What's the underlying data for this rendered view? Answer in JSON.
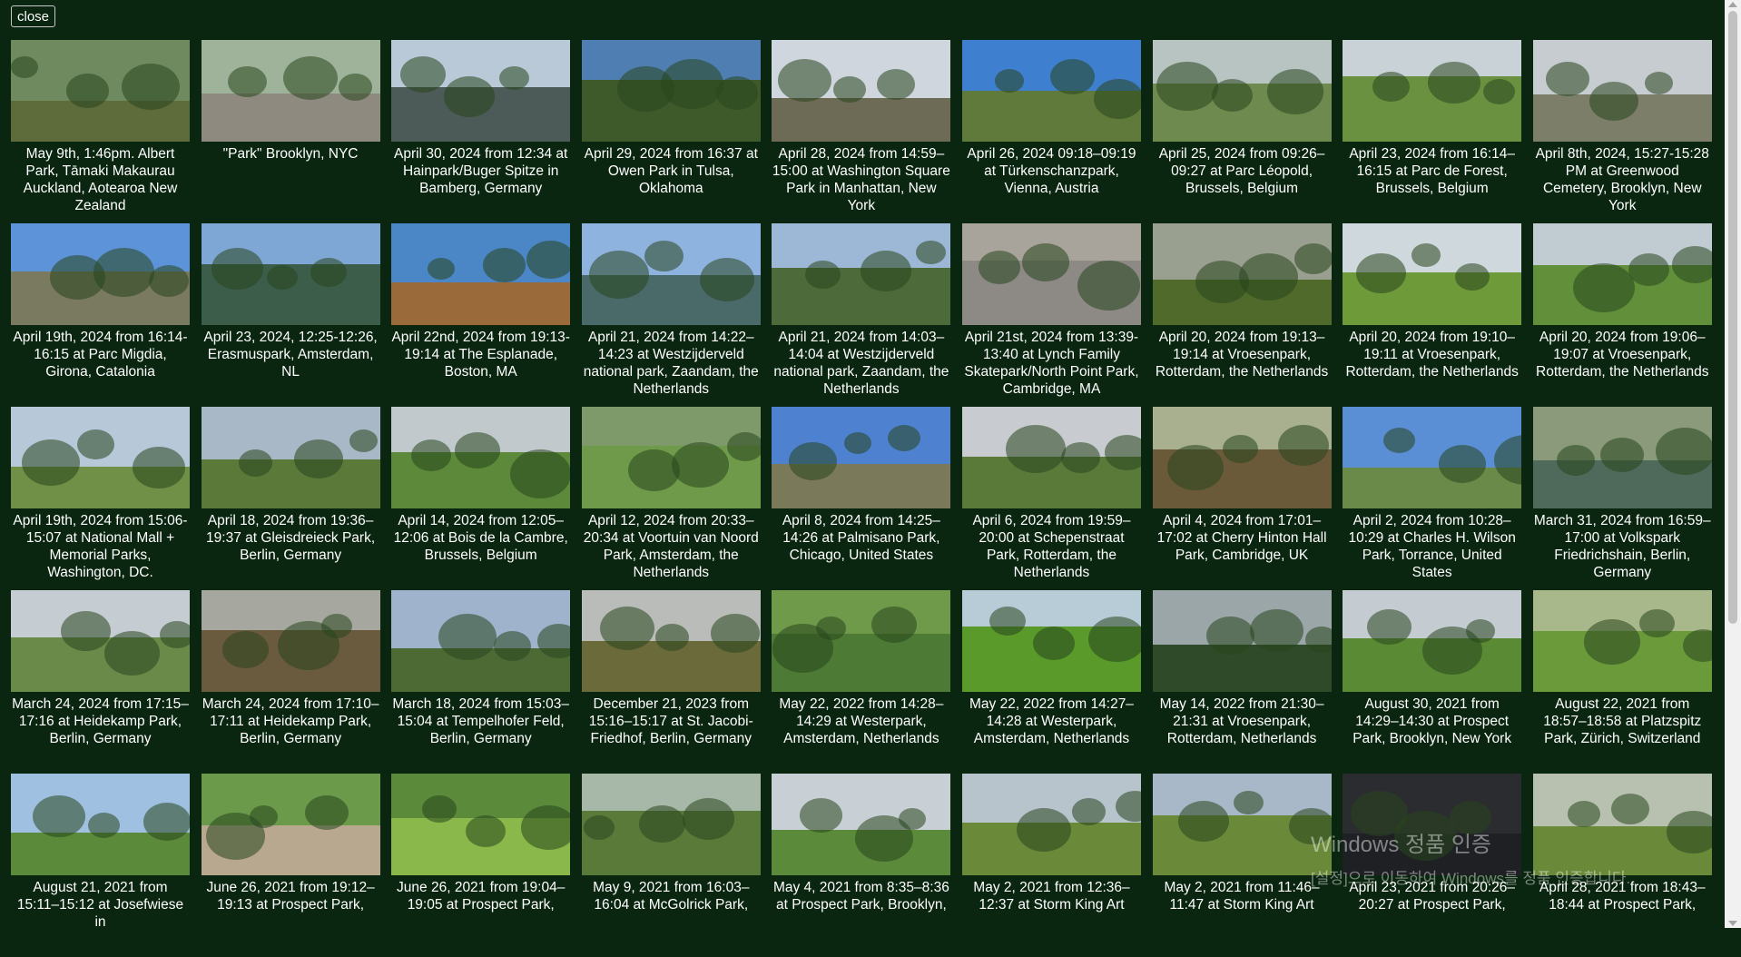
{
  "close_label": "close",
  "watermark": {
    "title": "Windows 정품 인증",
    "subtitle": "[설정]으로 이동하여 Windows를 정품 인증합니다."
  },
  "items": [
    {
      "caption": "May 9th, 1:46pm. Albert Park, Tāmaki Makaurau Auckland, Aotearoa New Zealand",
      "sky": "#6f8a5e",
      "ground": "#5e6b3a"
    },
    {
      "caption": "\"Park\" Brooklyn, NYC",
      "sky": "#9fb39a",
      "ground": "#8f8a80"
    },
    {
      "caption": "April 30, 2024 from 12:34 at Hainpark/Buger Spitze in Bamberg, Germany",
      "sky": "#b9c9d8",
      "ground": "#4c5a58"
    },
    {
      "caption": "April 29, 2024 from 16:37 at Owen Park in Tulsa, Oklahoma",
      "sky": "#4f7fb2",
      "ground": "#3f5a2a"
    },
    {
      "caption": "April 28, 2024 from 14:59–15:00 at Washington Square Park in Manhattan, New York",
      "sky": "#cfd6de",
      "ground": "#6d6a55"
    },
    {
      "caption": "April 26, 2024 09:18–09:19 at Türkenschanzpark, Vienna, Austria",
      "sky": "#3f7fd0",
      "ground": "#5f7a3a"
    },
    {
      "caption": "April 25, 2024 from 09:26–09:27 at Parc Léopold, Brussels, Belgium",
      "sky": "#b8c4c2",
      "ground": "#6f8a4e"
    },
    {
      "caption": "April 23, 2024 from 16:14–16:15 at Parc de Forest, Brussels, Belgium",
      "sky": "#c9d2d6",
      "ground": "#6a9140"
    },
    {
      "caption": "April 8th, 2024, 15:27-15:28 PM at Greenwood Cemetery, Brooklyn, New York",
      "sky": "#c7ccd0",
      "ground": "#7d7e6a"
    },
    {
      "caption": "April 19th, 2024 from 16:14-16:15 at Parc Migdia, Girona, Catalonia",
      "sky": "#5d93d8",
      "ground": "#7a7a60"
    },
    {
      "caption": "April 23, 2024, 12:25-12:26, Erasmuspark, Amsterdam, NL",
      "sky": "#7fa7d6",
      "ground": "#3b5d4a"
    },
    {
      "caption": "April 22nd, 2024 from 19:13-19:14 at The Esplanade, Boston, MA",
      "sky": "#4b86c6",
      "ground": "#9a6a3a"
    },
    {
      "caption": "April 21, 2024 from 14:22–14:23 at Westzijderveld national park, Zaandam, the Netherlands",
      "sky": "#8fb3df",
      "ground": "#4a6a6a"
    },
    {
      "caption": "April 21, 2024 from 14:03–14:04 at Westzijderveld national park, Zaandam, the Netherlands",
      "sky": "#9db8d6",
      "ground": "#4d6a3a"
    },
    {
      "caption": "April 21st, 2024 from 13:39-13:40 at Lynch Family Skatepark/North Point Park, Cambridge, MA",
      "sky": "#a8a49c",
      "ground": "#8d8a86"
    },
    {
      "caption": "April 20, 2024 from 19:13–19:14 at Vroesenpark, Rotterdam, the Netherlands",
      "sky": "#9aa08f",
      "ground": "#4f6a2a"
    },
    {
      "caption": "April 20, 2024 from 19:10–19:11 at Vroesenpark, Rotterdam, the Netherlands",
      "sky": "#cfd8dc",
      "ground": "#6f9a3a"
    },
    {
      "caption": "April 20, 2024 from 19:06–19:07 at Vroesenpark, Rotterdam, the Netherlands",
      "sky": "#c0ccd2",
      "ground": "#62903a"
    },
    {
      "caption": "April 19th, 2024 from 15:06-15:07 at National Mall + Memorial Parks, Washington, DC.",
      "sky": "#b7c8d8",
      "ground": "#6f9046"
    },
    {
      "caption": "April 18, 2024 from 19:36–19:37 at Gleisdreieck Park, Berlin, Germany",
      "sky": "#a9b8c7",
      "ground": "#5b7a3a"
    },
    {
      "caption": "April 14, 2024 from 12:05–12:06 at Bois de la Cambre, Brussels, Belgium",
      "sky": "#c2c9cc",
      "ground": "#5c8a3a"
    },
    {
      "caption": "April 12, 2024 from 20:33–20:34 at Voortuin van Noord Park, Amsterdam, the Netherlands",
      "sky": "#7f9a6a",
      "ground": "#6e9a4a"
    },
    {
      "caption": "April 8, 2024 from 14:25–14:26 at Palmisano Park, Chicago, United States",
      "sky": "#4e82d0",
      "ground": "#7a7a5a"
    },
    {
      "caption": "April 6, 2024 from 19:59–20:00 at Schepenstraat Park, Rotterdam, the Netherlands",
      "sky": "#c8ccd0",
      "ground": "#5a7a3a"
    },
    {
      "caption": "April 4, 2024 from 17:01–17:02 at Cherry Hinton Hall Park, Cambridge, UK",
      "sky": "#a8b090",
      "ground": "#6a5a3a"
    },
    {
      "caption": "April 2, 2024 from 10:28–10:29 at Charles H. Wilson Park, Torrance, United States",
      "sky": "#5a8fd6",
      "ground": "#6a8a4a"
    },
    {
      "caption": "March 31, 2024 from 16:59–17:00 at Volkspark Friedrichshain, Berlin, Germany",
      "sky": "#8a9a7a",
      "ground": "#4f6a5a"
    },
    {
      "caption": "March 24, 2024 from 17:15–17:16 at Heidekamp Park, Berlin, Germany",
      "sky": "#c6cdd2",
      "ground": "#6a8a4a"
    },
    {
      "caption": "March 24, 2024 from 17:10–17:11 at Heidekamp Park, Berlin, Germany",
      "sky": "#a6a8a0",
      "ground": "#6a5a3e"
    },
    {
      "caption": "March 18, 2024 from 15:03–15:04 at Tempelhofer Feld, Berlin, Germany",
      "sky": "#9fb3cc",
      "ground": "#4d6a34"
    },
    {
      "caption": "December 21, 2023 from 15:16–15:17 at St. Jacobi-Friedhof, Berlin, Germany",
      "sky": "#b9bcb8",
      "ground": "#6a6a3a"
    },
    {
      "caption": "May 22, 2022 from 14:28–14:29 at Westerpark, Amsterdam, Netherlands",
      "sky": "#6e9a4a",
      "ground": "#4d7a34"
    },
    {
      "caption": "May 22, 2022 from 14:27–14:28 at Westerpark, Amsterdam, Netherlands",
      "sky": "#b8ccd8",
      "ground": "#5a9a2a"
    },
    {
      "caption": "May 14, 2022 from 21:30–21:31 at Vroesenpark, Rotterdam, Netherlands",
      "sky": "#9aa6a8",
      "ground": "#2e4a28"
    },
    {
      "caption": "August 30, 2021 from 14:29–14:30 at Prospect Park, Brooklyn, New York",
      "sky": "#c4ccd2",
      "ground": "#5a8a34"
    },
    {
      "caption": "August 22, 2021 from 18:57–18:58 at Platzspitz Park, Zürich, Switzerland",
      "sky": "#a8b88a",
      "ground": "#6a9a3a"
    },
    {
      "caption": "August 21, 2021 from 15:11–15:12 at Josefwiese in",
      "sky": "#9fc0e0",
      "ground": "#5a8a3a"
    },
    {
      "caption": "June 26, 2021 from 19:12–19:13 at Prospect Park,",
      "sky": "#6a9a4a",
      "ground": "#b8a890"
    },
    {
      "caption": "June 26, 2021 from 19:04–19:05 at Prospect Park,",
      "sky": "#5a8a3a",
      "ground": "#8ab84a"
    },
    {
      "caption": "May 9, 2021 from 16:03–16:04 at McGolrick Park,",
      "sky": "#a8b8a8",
      "ground": "#5a7a3a"
    },
    {
      "caption": "May 4, 2021 from 8:35–8:36 at Prospect Park, Brooklyn,",
      "sky": "#c8d0d6",
      "ground": "#5a8a3a"
    },
    {
      "caption": "May 2, 2021 from 12:36–12:37 at Storm King Art",
      "sky": "#b8c4cc",
      "ground": "#6a8a3a"
    },
    {
      "caption": "May 2, 2021 from 11:46–11:47 at Storm King Art",
      "sky": "#a8b8c8",
      "ground": "#6a8a3a"
    },
    {
      "caption": "April 23, 2021 from 20:26–20:27 at Prospect Park,",
      "sky": "#2a2c30",
      "ground": "#1e2024"
    },
    {
      "caption": "April 28, 2021 from 18:43–18:44 at Prospect Park,",
      "sky": "#b8c0b0",
      "ground": "#6a8a3a"
    }
  ]
}
